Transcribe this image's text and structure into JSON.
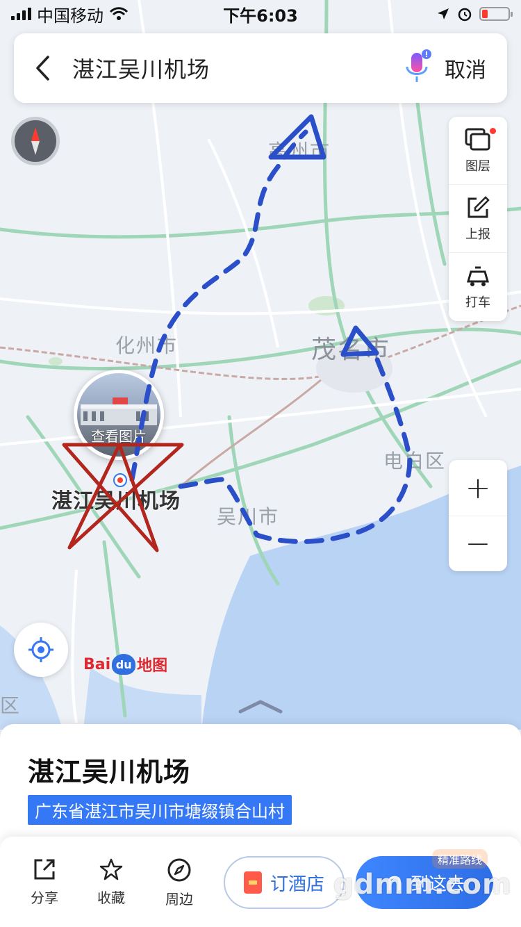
{
  "status_bar": {
    "carrier": "中国移动",
    "time": "下午6:03"
  },
  "search": {
    "query": "湛江吴川机场",
    "cancel_label": "取消"
  },
  "tools": [
    {
      "label": "图层",
      "icon": "layers-icon"
    },
    {
      "label": "上报",
      "icon": "report-icon"
    },
    {
      "label": "打车",
      "icon": "taxi-icon"
    }
  ],
  "zoom": {
    "in": "+",
    "out": "−"
  },
  "map": {
    "labels": {
      "gaozhou": "高州市",
      "huazhou": "化州市",
      "maoming": "茂名市",
      "dianbai": "电白区",
      "wuchuan": "吴川市",
      "edge": "区"
    },
    "airport_label": "湛江吴川机场",
    "photo_label": "查看图片"
  },
  "logo": {
    "part1": "Bai",
    "paw": "du",
    "part2": "地图"
  },
  "place": {
    "name": "湛江吴川机场",
    "address": "广东省湛江市吴川市塘缀镇合山村"
  },
  "actions": [
    {
      "label": "分享",
      "icon": "share-icon"
    },
    {
      "label": "收藏",
      "icon": "star-icon"
    },
    {
      "label": "周边",
      "icon": "compass-icon"
    }
  ],
  "hotel_button": "订酒店",
  "route_button": "到这去",
  "route_tag": "精准路线",
  "watermark": "gdmm.com",
  "colors": {
    "accent": "#3478f6",
    "annotation_blue": "#2b4fc8",
    "annotation_red": "#b3261e",
    "sea": "#b9d3f5"
  }
}
